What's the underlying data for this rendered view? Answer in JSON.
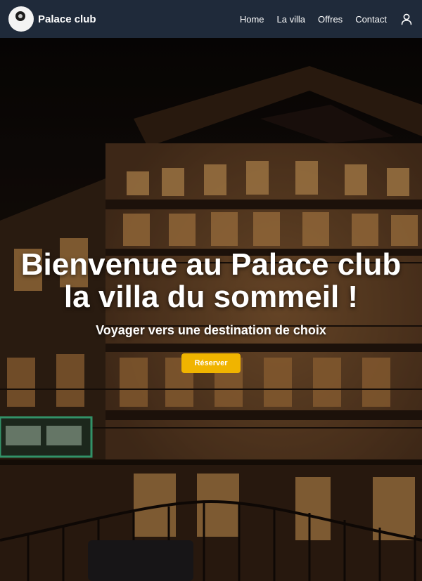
{
  "header": {
    "brand": "Palace club",
    "nav": [
      {
        "label": "Home"
      },
      {
        "label": "La villa"
      },
      {
        "label": "Offres"
      },
      {
        "label": "Contact"
      }
    ],
    "user_icon": "user-icon"
  },
  "hero": {
    "title_line1": "Bienvenue au Palace club",
    "title_line2": "la villa du sommeil !",
    "subtitle": "Voyager vers une destination de choix",
    "cta_label": "Réserver",
    "cta_color": "#f0b400"
  },
  "colors": {
    "navbar_bg": "#1f2a3a",
    "text": "#ffffff"
  }
}
